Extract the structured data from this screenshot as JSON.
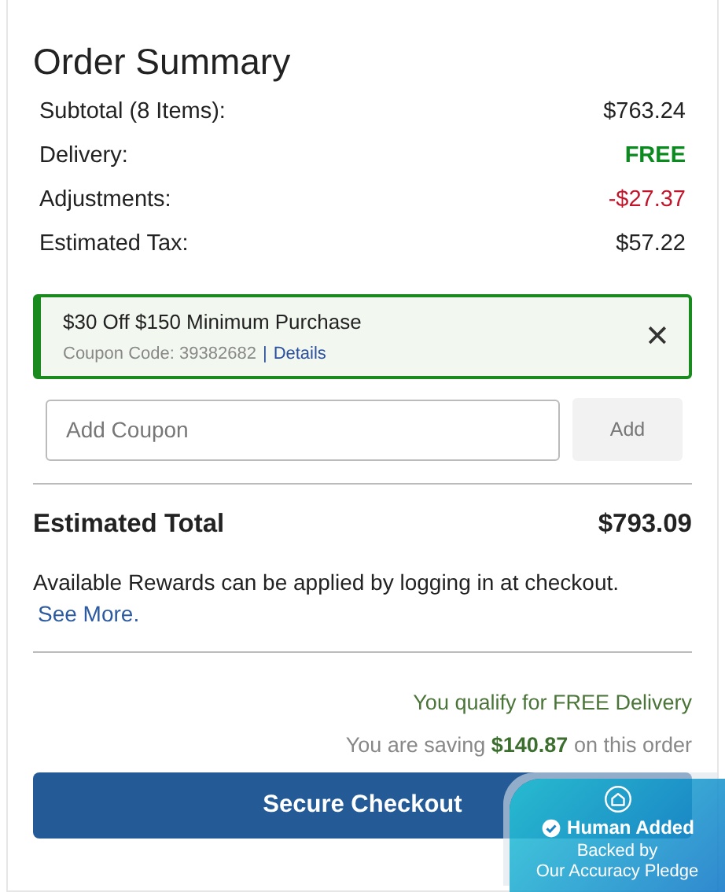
{
  "title": "Order Summary",
  "lines": [
    {
      "label": "Subtotal (8 Items):",
      "value": "$763.24",
      "kind": "normal"
    },
    {
      "label": "Delivery:",
      "value": "FREE",
      "kind": "free"
    },
    {
      "label": "Adjustments:",
      "value": "-$27.37",
      "kind": "discount"
    },
    {
      "label": "Estimated Tax:",
      "value": "$57.22",
      "kind": "normal"
    }
  ],
  "coupon": {
    "title": "$30 Off $150 Minimum Purchase",
    "code": "Coupon Code: 39382682",
    "separator": "|",
    "link": "Details",
    "close": "✕"
  },
  "coupon_field": {
    "placeholder": "Add Coupon",
    "button": "Add",
    "disabled": true
  },
  "total": {
    "label": "Estimated Total",
    "value": "$793.09"
  },
  "rewards": {
    "text": "Available Rewards can be applied by logging in at checkout.",
    "link": "See More."
  },
  "qualify": "You qualify for FREE Delivery",
  "saving": "You are saving **$140.87** on this order",
  "checkout": "Secure Checkout",
  "badge": {
    "title": "Human Added",
    "line_1": "Backed by",
    "line_2": "Our Accuracy Pledge"
  }
}
